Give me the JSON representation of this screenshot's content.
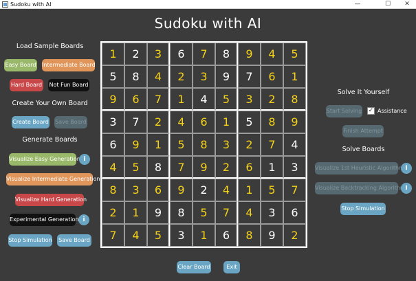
{
  "window": {
    "title": "Sudoku with AI",
    "minimize": "—",
    "maximize": "☐",
    "close": "✕"
  },
  "app_title": "Sudoku with AI",
  "left": {
    "load_heading": "Load Sample Boards",
    "easy_board": "Easy Board",
    "intermediate_board": "Intermediate Board",
    "hard_board": "Hard Board",
    "not_fun_board": "Not Fun Board",
    "create_heading": "Create Your Own Board",
    "create_board": "Create Board",
    "save_board_disabled": "Save Board",
    "generate_heading": "Generate Boards",
    "vis_easy": "Visualize Easy Generation",
    "vis_intermediate": "Visualize Intermediate Generation",
    "vis_hard": "Visualize Hard Generation",
    "experimental": "Experimental Generation",
    "stop_simulation": "Stop Simulation",
    "save_board": "Save Board",
    "info": "i"
  },
  "right": {
    "solve_yourself_heading": "Solve It Yourself",
    "start_solving": "Start Solving",
    "assistance_label": "Assistance",
    "assistance_checked": "✓",
    "finish_attempt": "Finish Attempt",
    "solve_boards_heading": "Solve Boards",
    "vis_heuristic": "Visualize 1st Heuristic Algorithm",
    "vis_backtracking": "Visualize Backtracking Algorithm",
    "stop_simulation": "Stop Simulation",
    "info": "i"
  },
  "bottom": {
    "clear_board": "Clear Board",
    "exit": "Exit"
  },
  "colors": {
    "given": "#ffffff",
    "solved": "#f5d21a"
  },
  "board": [
    [
      {
        "v": "1",
        "s": 1
      },
      {
        "v": "2",
        "s": 0
      },
      {
        "v": "3",
        "s": 1
      },
      {
        "v": "6",
        "s": 0
      },
      {
        "v": "7",
        "s": 1
      },
      {
        "v": "8",
        "s": 0
      },
      {
        "v": "9",
        "s": 1
      },
      {
        "v": "4",
        "s": 1
      },
      {
        "v": "5",
        "s": 1
      }
    ],
    [
      {
        "v": "5",
        "s": 0
      },
      {
        "v": "8",
        "s": 0
      },
      {
        "v": "4",
        "s": 1
      },
      {
        "v": "2",
        "s": 1
      },
      {
        "v": "3",
        "s": 1
      },
      {
        "v": "9",
        "s": 0
      },
      {
        "v": "7",
        "s": 0
      },
      {
        "v": "6",
        "s": 1
      },
      {
        "v": "1",
        "s": 1
      }
    ],
    [
      {
        "v": "9",
        "s": 1
      },
      {
        "v": "6",
        "s": 1
      },
      {
        "v": "7",
        "s": 1
      },
      {
        "v": "1",
        "s": 1
      },
      {
        "v": "4",
        "s": 0
      },
      {
        "v": "5",
        "s": 1
      },
      {
        "v": "3",
        "s": 1
      },
      {
        "v": "2",
        "s": 1
      },
      {
        "v": "8",
        "s": 1
      }
    ],
    [
      {
        "v": "3",
        "s": 0
      },
      {
        "v": "7",
        "s": 0
      },
      {
        "v": "2",
        "s": 1
      },
      {
        "v": "4",
        "s": 1
      },
      {
        "v": "6",
        "s": 1
      },
      {
        "v": "1",
        "s": 1
      },
      {
        "v": "5",
        "s": 0
      },
      {
        "v": "8",
        "s": 1
      },
      {
        "v": "9",
        "s": 1
      }
    ],
    [
      {
        "v": "6",
        "s": 0
      },
      {
        "v": "9",
        "s": 1
      },
      {
        "v": "1",
        "s": 1
      },
      {
        "v": "5",
        "s": 1
      },
      {
        "v": "8",
        "s": 1
      },
      {
        "v": "3",
        "s": 1
      },
      {
        "v": "2",
        "s": 1
      },
      {
        "v": "7",
        "s": 1
      },
      {
        "v": "4",
        "s": 0
      }
    ],
    [
      {
        "v": "4",
        "s": 1
      },
      {
        "v": "5",
        "s": 1
      },
      {
        "v": "8",
        "s": 0
      },
      {
        "v": "7",
        "s": 1
      },
      {
        "v": "9",
        "s": 1
      },
      {
        "v": "2",
        "s": 1
      },
      {
        "v": "6",
        "s": 1
      },
      {
        "v": "1",
        "s": 0
      },
      {
        "v": "3",
        "s": 0
      }
    ],
    [
      {
        "v": "8",
        "s": 1
      },
      {
        "v": "3",
        "s": 1
      },
      {
        "v": "6",
        "s": 1
      },
      {
        "v": "9",
        "s": 1
      },
      {
        "v": "2",
        "s": 0
      },
      {
        "v": "4",
        "s": 1
      },
      {
        "v": "1",
        "s": 1
      },
      {
        "v": "5",
        "s": 1
      },
      {
        "v": "7",
        "s": 1
      }
    ],
    [
      {
        "v": "2",
        "s": 1
      },
      {
        "v": "1",
        "s": 1
      },
      {
        "v": "9",
        "s": 0
      },
      {
        "v": "8",
        "s": 0
      },
      {
        "v": "5",
        "s": 1
      },
      {
        "v": "7",
        "s": 1
      },
      {
        "v": "4",
        "s": 1
      },
      {
        "v": "3",
        "s": 0
      },
      {
        "v": "6",
        "s": 0
      }
    ],
    [
      {
        "v": "7",
        "s": 1
      },
      {
        "v": "4",
        "s": 1
      },
      {
        "v": "5",
        "s": 1
      },
      {
        "v": "3",
        "s": 0
      },
      {
        "v": "1",
        "s": 1
      },
      {
        "v": "6",
        "s": 0
      },
      {
        "v": "8",
        "s": 1
      },
      {
        "v": "9",
        "s": 0
      },
      {
        "v": "2",
        "s": 1
      }
    ]
  ]
}
